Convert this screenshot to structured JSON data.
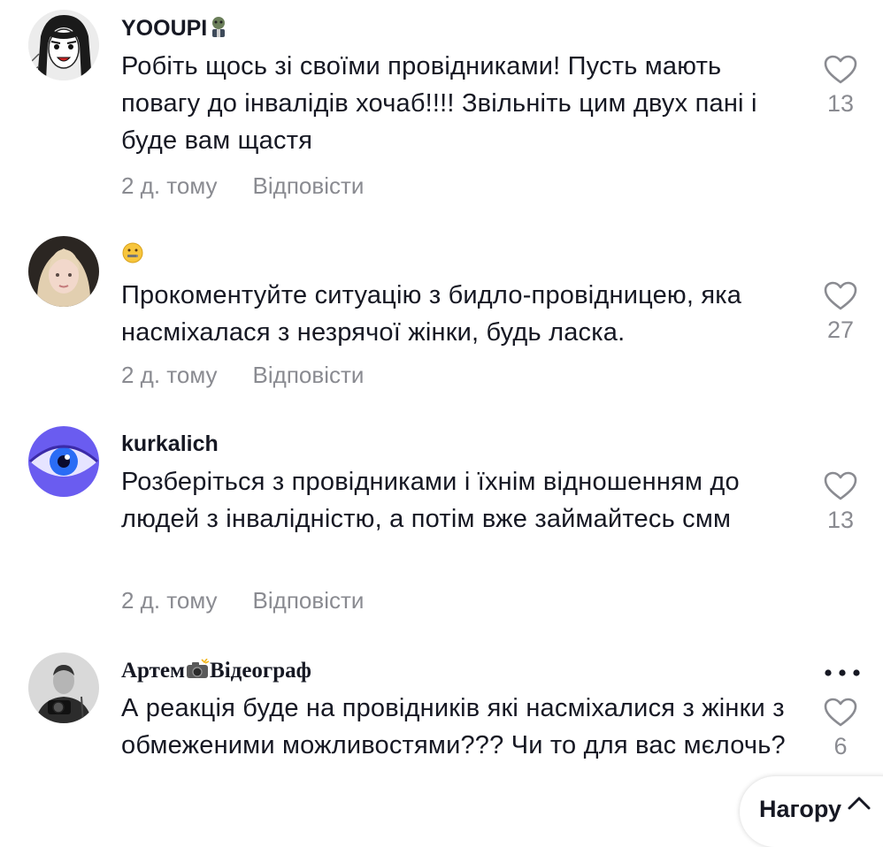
{
  "comments": [
    {
      "username": "YOOUPI",
      "username_emoji": "zombie-icon",
      "text": "Робіть щось зі своїми провідниками! Пусть мають повагу до інвалідів хочаб!!!! Звільніть цим двух пані і буде вам щастя",
      "time": "2 д. тому",
      "reply_label": "Відповісти",
      "likes": "13",
      "avatar": "anime-girl-drawing"
    },
    {
      "username": "",
      "username_emoji": "zipper-mouth-face-icon",
      "text": "Прокоментуйте ситуацію з бидло-провідницею, яка насміхалася з незрячої жінки, будь ласка.",
      "time": "2 д. тому",
      "reply_label": "Відповісти",
      "likes": "27",
      "avatar": "blonde-woman-photo"
    },
    {
      "username": "kurkalich",
      "text": "Розберіться з провідниками і їхнім відношенням до людей з інвалідністю, а потім вже займайтесь смм",
      "time": "2 д. тому",
      "reply_label": "Відповісти",
      "likes": "13",
      "avatar": "blue-eye-photo"
    },
    {
      "username_part1": "Артем",
      "username_emoji": "camera-flash-icon",
      "username_part2": "Відеограф",
      "text": "А реакція буде на провідників які насміхалися з жінки з обмеженими можливостями??? Чи то для вас мєлочь?",
      "likes": "6",
      "avatar": "man-with-camera-bw-photo"
    }
  ],
  "back_to_top": {
    "label": "Нагору"
  },
  "colors": {
    "text": "#161823",
    "muted": "#8a8b91",
    "background": "#ffffff"
  }
}
